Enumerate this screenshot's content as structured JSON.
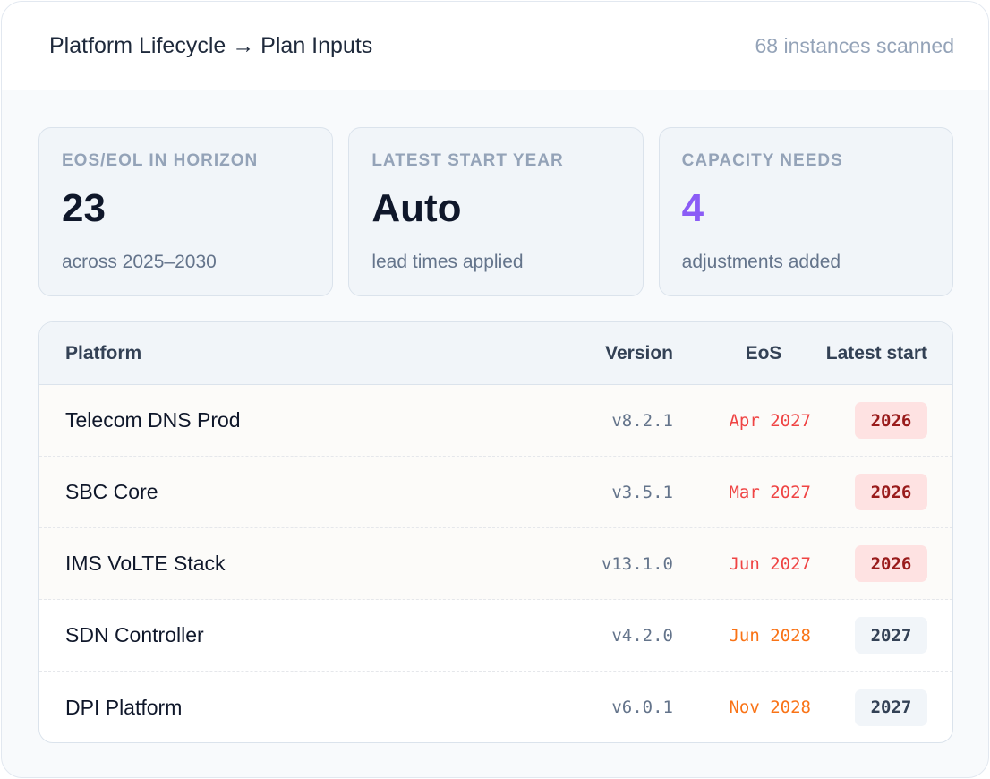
{
  "header": {
    "title": "Platform Lifecycle → Plan Inputs",
    "subtitle": "68 instances scanned"
  },
  "stats": [
    {
      "label": "EOS/EOL IN HORIZON",
      "value": "23",
      "note": "across 2025–2030"
    },
    {
      "label": "LATEST START YEAR",
      "value": "Auto",
      "note": "lead times applied"
    },
    {
      "label": "CAPACITY NEEDS",
      "value": "4",
      "note": "adjustments added"
    }
  ],
  "table": {
    "columns": {
      "platform": "Platform",
      "version": "Version",
      "eos": "EoS",
      "start": "Latest start"
    },
    "rows": [
      {
        "platform": "Telecom DNS Prod",
        "version": "v8.2.1",
        "eos": "Apr 2027",
        "start": "2026"
      },
      {
        "platform": "SBC Core",
        "version": "v3.5.1",
        "eos": "Mar 2027",
        "start": "2026"
      },
      {
        "platform": "IMS VoLTE Stack",
        "version": "v13.1.0",
        "eos": "Jun 2027",
        "start": "2026"
      },
      {
        "platform": "SDN Controller",
        "version": "v4.2.0",
        "eos": "Jun 2028",
        "start": "2027"
      },
      {
        "platform": "DPI Platform",
        "version": "v6.0.1",
        "eos": "Nov 2028",
        "start": "2027"
      }
    ]
  },
  "colors": {
    "accent_purple": "#8b5cf6",
    "eos_urgent": "#ef4444",
    "eos_later": "#f97316",
    "badge_urgent_bg": "#fee2e2",
    "badge_urgent_text": "#991b1b"
  }
}
